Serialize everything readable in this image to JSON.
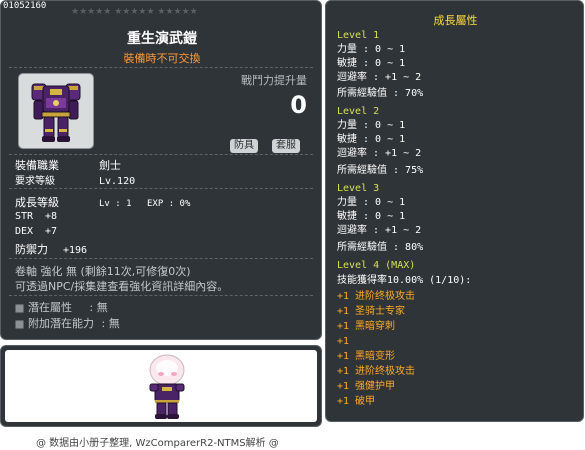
{
  "item": {
    "id": "01052160",
    "stars": "★★★★★ ★★★★★ ★★★★★",
    "name": "重生演武鎧",
    "note": "裝備時不可交換",
    "power_label": "戰鬥力提升量",
    "power_value": "0",
    "tags": [
      "防具",
      "套服"
    ],
    "icon": "armor-icon"
  },
  "requirements": [
    {
      "label": "裝備職業",
      "value": "劍士"
    },
    {
      "label": "要求等級",
      "value": "Lv.120"
    }
  ],
  "growth": {
    "label": "成長等級",
    "level": "Lv : 1",
    "exp": "EXP : 0%"
  },
  "stats": [
    {
      "label": "STR",
      "value": "+8"
    },
    {
      "label": "DEX",
      "value": "+7"
    },
    {
      "label": "防禦力",
      "value": "+196"
    }
  ],
  "upgrade": "卷軸 強化 無 (剩餘11次,可修復0次)",
  "npc_hint": "可透過NPC/採集建查看強化資訊詳細內容。",
  "potentials": [
    {
      "label": "潛在屬性",
      "value": ": 無"
    },
    {
      "label": "附加潛在能力",
      "value": ": 無"
    }
  ],
  "preview": {
    "character": "character-preview"
  },
  "footer": "@ 数据由小册子整理, WzComparerR2-NTMS解析 @",
  "growth_panel": {
    "title": "成長屬性",
    "levels": [
      {
        "heading": "Level 1",
        "lines": [
          "力量 : 0 ~ 1",
          "敏捷 : 0 ~ 1",
          "迴避率 : +1 ~ 2",
          "所需經驗值 : 70%"
        ]
      },
      {
        "heading": "Level 2",
        "lines": [
          "力量 : 0 ~ 1",
          "敏捷 : 0 ~ 1",
          "迴避率 : +1 ~ 2",
          "所需經驗值 : 75%"
        ]
      },
      {
        "heading": "Level 3",
        "lines": [
          "力量 : 0 ~ 1",
          "敏捷 : 0 ~ 1",
          "迴避率 : +1 ~ 2",
          "所需經驗值 : 80%"
        ]
      }
    ],
    "level4": {
      "heading": "Level 4 (MAX)",
      "skill_rate": "技能獲得率10.00% (1/10):",
      "skills": [
        "+1 进阶终极攻击",
        "+1 圣骑士专家",
        "+1 黑暗穿刺",
        "+1",
        "+1 黑暗变形",
        "+1 进阶终极攻击",
        "+1 强健护甲",
        "+1 破甲"
      ]
    }
  }
}
